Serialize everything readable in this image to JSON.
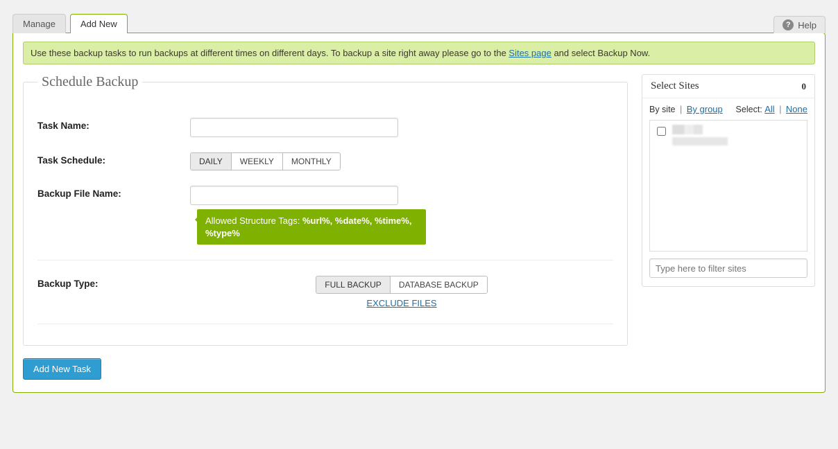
{
  "tabs": {
    "manage": "Manage",
    "add_new": "Add New"
  },
  "help": {
    "label": "Help"
  },
  "notice": {
    "pre": "Use these backup tasks to run backups at different times on different days. To backup a site right away please go to the ",
    "link": "Sites page",
    "post": " and select Backup Now."
  },
  "schedule": {
    "legend": "Schedule Backup",
    "task_name_label": "Task Name:",
    "task_schedule_label": "Task Schedule:",
    "schedule_options": {
      "daily": "DAILY",
      "weekly": "WEEKLY",
      "monthly": "MONTHLY"
    },
    "backup_filename_label": "Backup File Name:",
    "tooltip_lead": "Allowed Structure Tags: ",
    "tooltip_tags": "%url%, %date%, %time%, %type%",
    "backup_type_label": "Backup Type:",
    "type_options": {
      "full": "FULL BACKUP",
      "db": "DATABASE BACKUP"
    },
    "exclude_files": "EXCLUDE FILES"
  },
  "actions": {
    "add_new_task": "Add New Task"
  },
  "sites": {
    "title": "Select Sites",
    "count": "0",
    "by_site": "By site",
    "by_group": "By group",
    "select_label": "Select:",
    "select_all": "All",
    "select_none": "None",
    "filter_placeholder": "Type here to filter sites"
  }
}
